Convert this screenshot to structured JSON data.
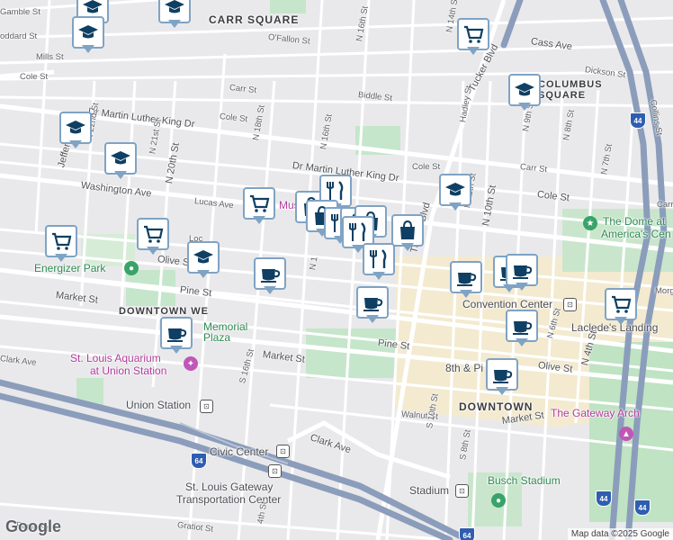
{
  "map": {
    "attribution": "Map data ©2025 Google",
    "logo": "Google",
    "colors": {
      "park": "#bfe3c6",
      "downtown": "#f4ecd2",
      "road": "#ffffff",
      "highway": "#8a9bb8",
      "marker_border": "#7fa3c4",
      "marker_icon": "#0f3f63",
      "water": "#a9d4e8"
    }
  },
  "labels": {
    "gamble_st": "Gamble St",
    "oddard_st": "oddard St",
    "mills_st": "Mills St",
    "cole_st_w": "Cole St",
    "carr_square": "CARR SQUARE",
    "ofallon_st": "O'Fallon St",
    "carr_st_mid": "Carr St",
    "biddle_st": "Biddle St",
    "cole_st_mid": "Cole St",
    "n16th_top": "N 16th St",
    "n14th_top": "N 14th St",
    "cass_ave": "Cass Ave",
    "columbus_square": "COLUMBUS SQUARE",
    "dickson_st": "Dickson St",
    "collins_st": "Collins St",
    "mlk_dr_w": "Dr Martin Luther King Dr",
    "mlk_dr_e": "Dr Martin Luther King Dr",
    "n22nd_st": "N 22nd St",
    "n21st_st": "N 21st St",
    "n20th_st": "N 20th St",
    "n18th_st": "N 18th St",
    "n16th_st_mid": "N 16th St",
    "jefferson": "Jefferson",
    "washington_ave": "Washington Ave",
    "lucas_ave": "Lucas Ave",
    "cole_st_east": "Cole St",
    "cole_st_e2": "Cole St",
    "carr_st_e": "Carr St",
    "hadley_st": "Hadley St",
    "n11th_st": "N 11th St",
    "n10th_st": "N 10th St",
    "n9th_st": "N 9th St",
    "n8th_st": "N 8th St",
    "n7th_st": "N 7th St",
    "tucker_blvd_n": "Tucker Blvd",
    "tucker_blvd": "Tucker Blvd",
    "the_dome": "The Dome at",
    "americas_center": "America's Cen",
    "energizer_park": "Energizer Park",
    "olive_st_w": "Olive St",
    "loc": "Loc",
    "pine_st_w": "Pine St",
    "market_st_w": "Market St",
    "downtown_west": "DOWNTOWN WE",
    "memorial_plaza": "Memorial Plaza",
    "convention_center": "Convention Center",
    "morgan": "Morg",
    "lacledes_landing": "Laclede's Landing",
    "pine_st_e": "Pine St",
    "market_st_mid": "Market St",
    "clark_ave_w": "Clark Ave",
    "aquarium_1": "St. Louis Aquarium",
    "aquarium_2": "at Union Station",
    "eighth_pine": "8th & Pi",
    "olive_st_e": "Olive St",
    "n4th_st": "N 4th St",
    "n6th_st": "N 6th St",
    "downtown": "DOWNTOWN",
    "s16th_st": "S 16th St",
    "union_station": "Union Station",
    "walnut_st": "Walnut St",
    "s10th_st": "S 10th St",
    "market_st_e": "Market St",
    "gateway_arch": "The Gateway Arch",
    "clark_ave_mid": "Clark Ave",
    "civic_center": "Civic Center",
    "gateway_tc_1": "St. Louis Gateway",
    "gateway_tc_2": "Transportation Center",
    "s8th_st": "S 8th St",
    "busch_stadium": "Busch Stadium",
    "stadium": "Stadium",
    "gratiot_st": "Gratiot St",
    "papin_st": "Papin St",
    "s14th_st": "4th St",
    "n12th_a": "N 1",
    "carr_partial": "Carr",
    "mus_partial": "Mus"
  },
  "markers": [
    {
      "icon": "school-icon"
    },
    {
      "icon": "school-icon"
    },
    {
      "icon": "school-icon"
    },
    {
      "icon": "grocery-icon"
    },
    {
      "icon": "school-icon"
    },
    {
      "icon": "school-icon"
    },
    {
      "icon": "school-icon"
    },
    {
      "icon": "grocery-icon"
    },
    {
      "icon": "grocery-icon"
    },
    {
      "icon": "grocery-icon"
    },
    {
      "icon": "shopping-bag-icon"
    },
    {
      "icon": "restaurant-icon"
    },
    {
      "icon": "shopping-bag-icon"
    },
    {
      "icon": "restaurant-icon"
    },
    {
      "icon": "shopping-bag-icon"
    },
    {
      "icon": "shopping-bag-icon"
    },
    {
      "icon": "restaurant-icon"
    },
    {
      "icon": "shopping-bag-icon"
    },
    {
      "icon": "school-icon"
    },
    {
      "icon": "school-icon"
    },
    {
      "icon": "coffee-icon"
    },
    {
      "icon": "restaurant-icon"
    },
    {
      "icon": "coffee-icon"
    },
    {
      "icon": "coffee-icon"
    },
    {
      "icon": "coffee-icon"
    },
    {
      "icon": "coffee-icon"
    },
    {
      "icon": "grocery-icon"
    },
    {
      "icon": "coffee-icon"
    },
    {
      "icon": "coffee-icon"
    },
    {
      "icon": "coffee-icon"
    }
  ],
  "highway_shields": [
    "44",
    "44",
    "64",
    "64",
    "44"
  ]
}
